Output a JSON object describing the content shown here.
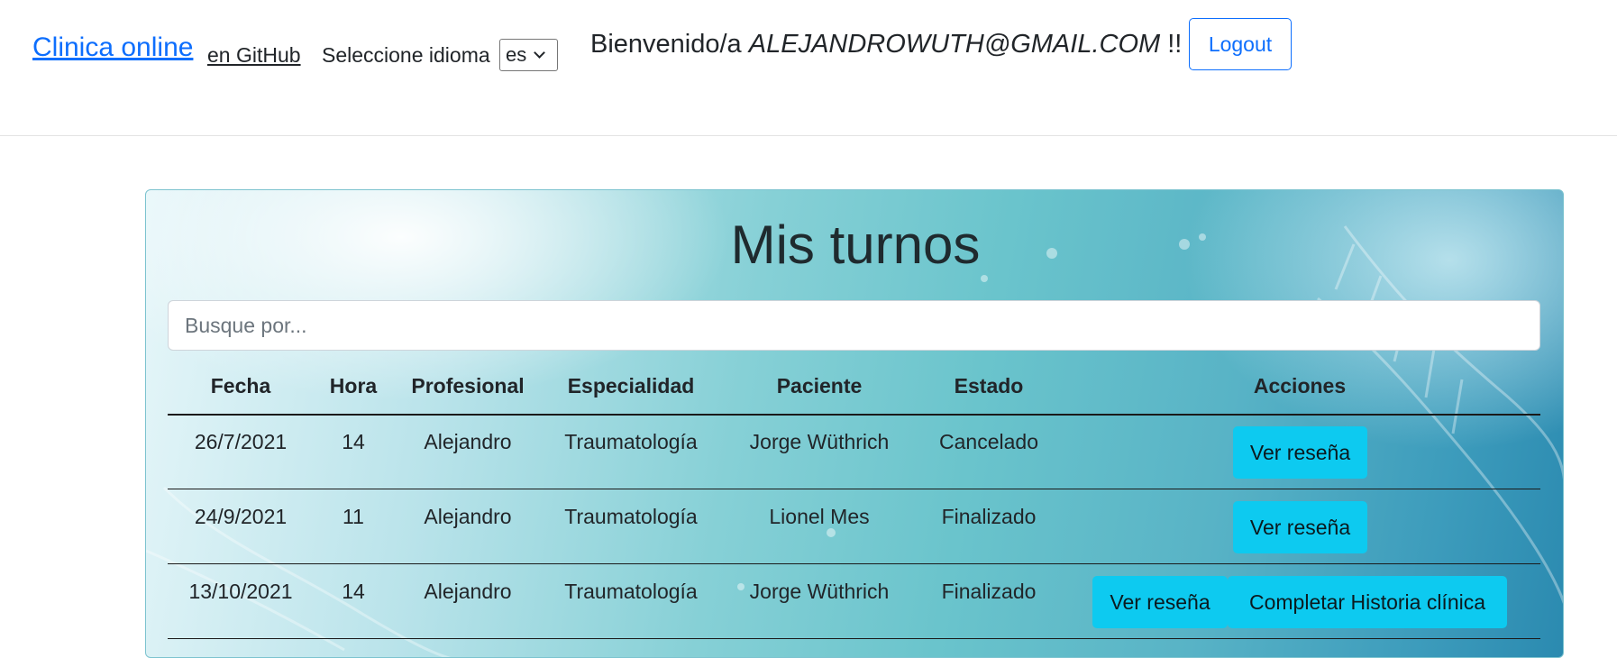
{
  "navbar": {
    "brand": "Clinica online",
    "github_link": "en GitHub",
    "language_label": "Seleccione idioma",
    "language_selected": "es",
    "welcome_prefix": "Bienvenido/a",
    "user_email": "ALEJANDROWUTH@GMAIL.COM",
    "welcome_suffix": "!!",
    "logout_label": "Logout"
  },
  "main": {
    "title": "Mis turnos",
    "search_placeholder": "Busque por...",
    "columns": [
      "Fecha",
      "Hora",
      "Profesional",
      "Especialidad",
      "Paciente",
      "Estado",
      "Acciones"
    ],
    "rows": [
      {
        "fecha": "26/7/2021",
        "hora": "14",
        "profesional": "Alejandro",
        "especialidad": "Traumatología",
        "paciente": "Jorge Wüthrich",
        "estado": "Cancelado",
        "acciones": [
          "Ver reseña"
        ]
      },
      {
        "fecha": "24/9/2021",
        "hora": "11",
        "profesional": "Alejandro",
        "especialidad": "Traumatología",
        "paciente": "Lionel Mes",
        "estado": "Finalizado",
        "acciones": [
          "Ver reseña"
        ]
      },
      {
        "fecha": "13/10/2021",
        "hora": "14",
        "profesional": "Alejandro",
        "especialidad": "Traumatología",
        "paciente": "Jorge Wüthrich",
        "estado": "Finalizado",
        "acciones": [
          "Ver reseña",
          "Completar Historia clínica"
        ]
      }
    ]
  },
  "colors": {
    "primary": "#0d6efd",
    "info_button": "#0dcaf0",
    "card_gradient_mid": "#6ac4cc"
  }
}
